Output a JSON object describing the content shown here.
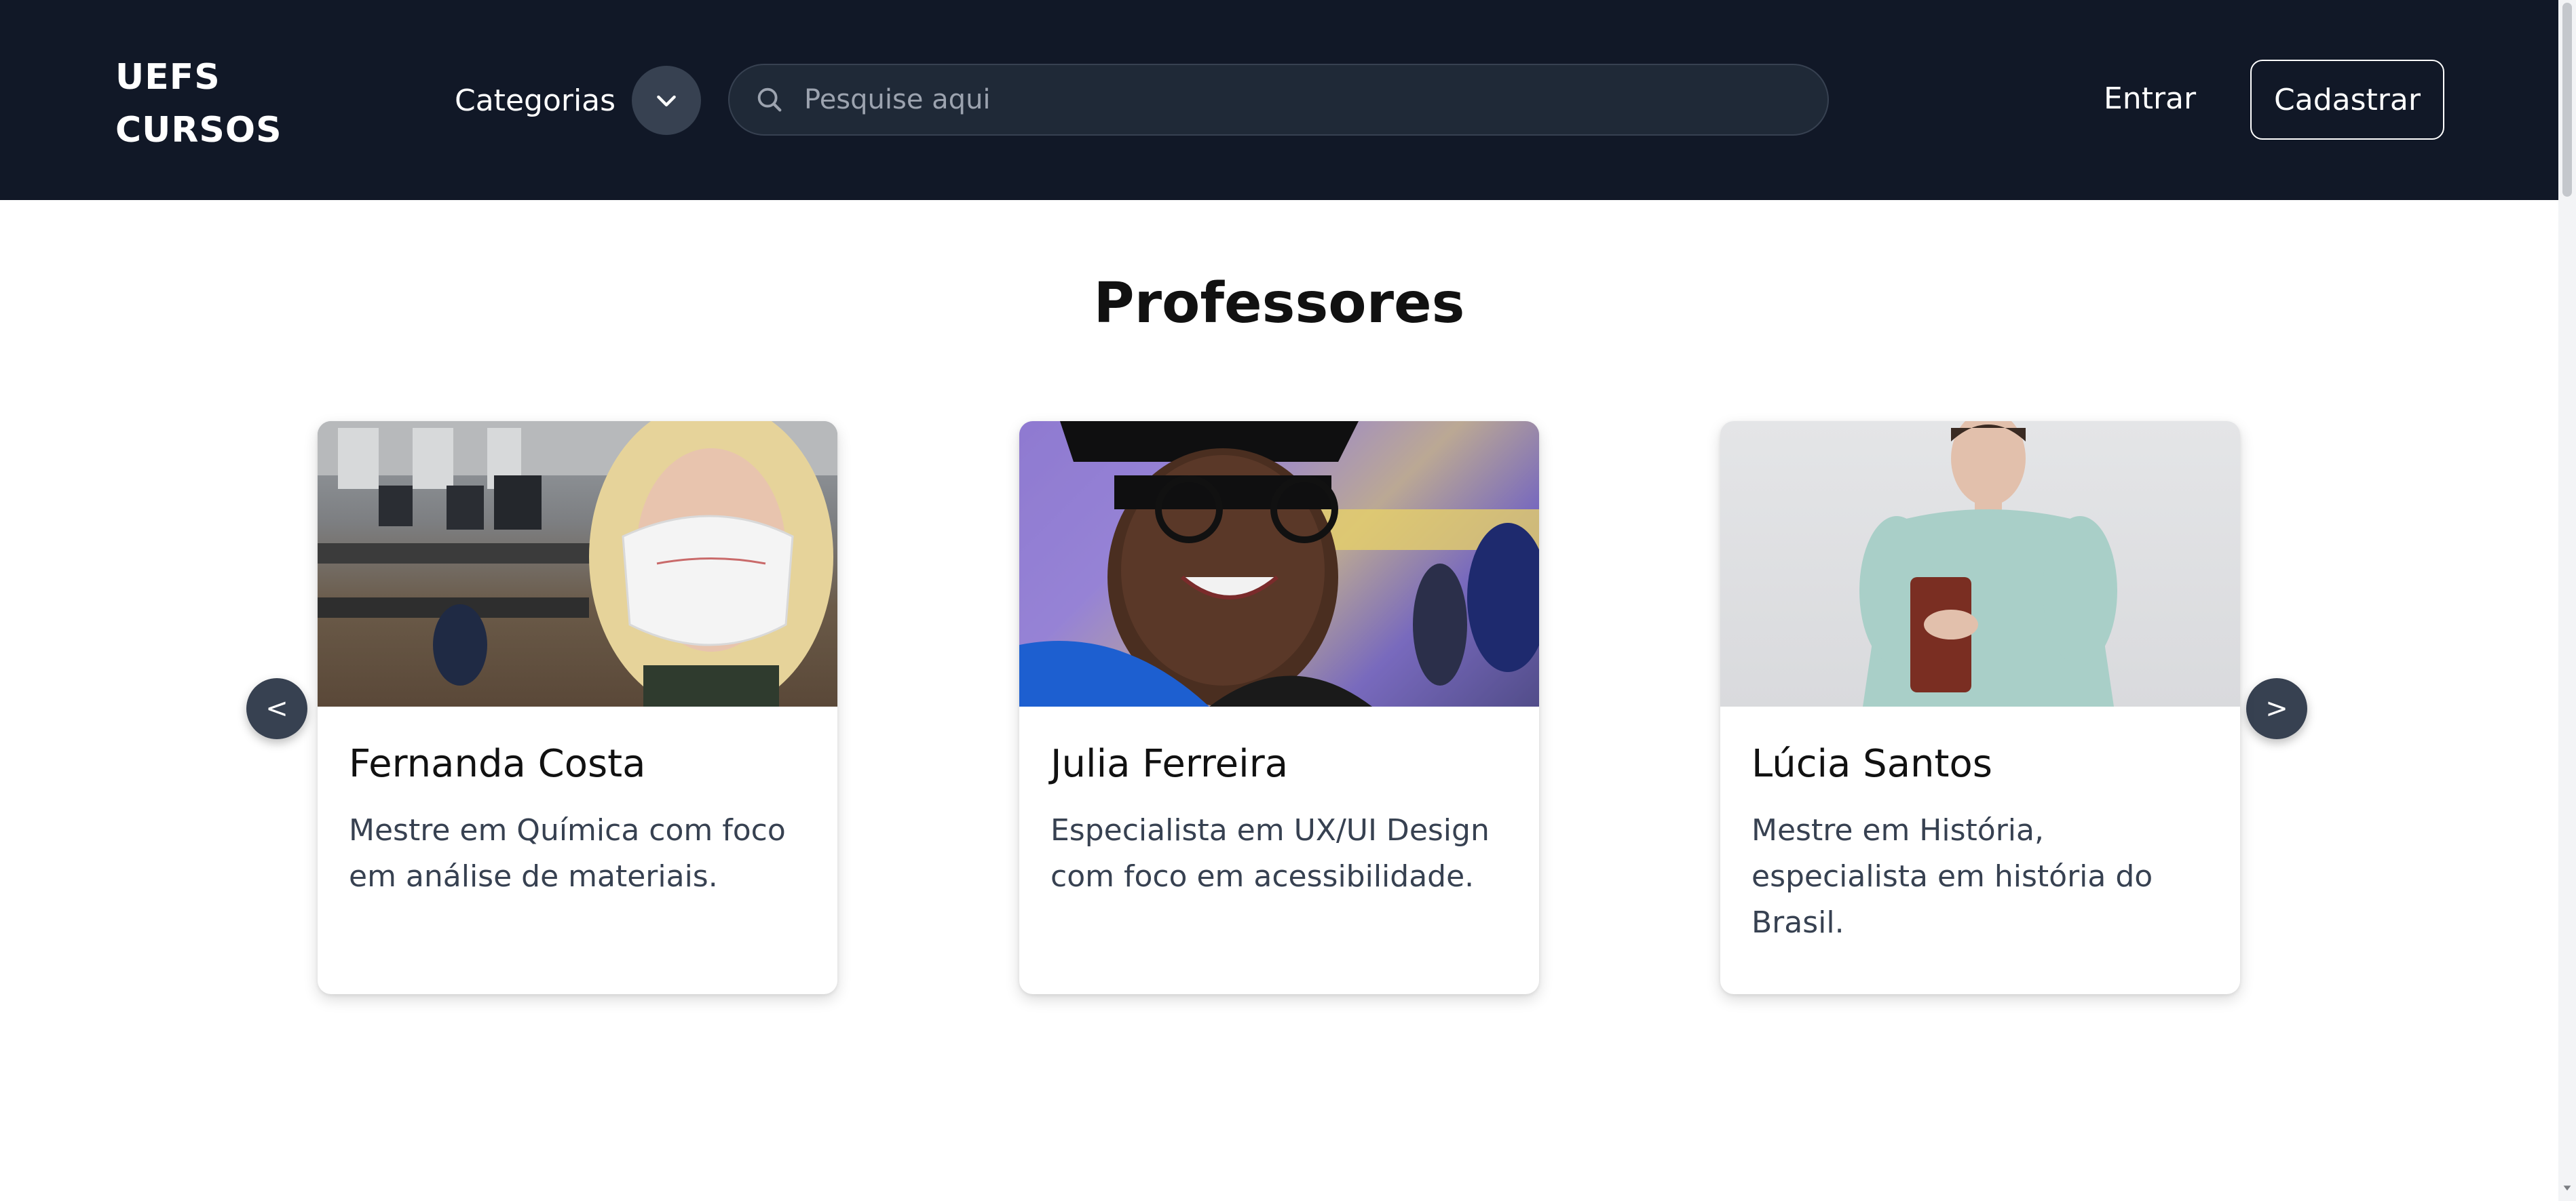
{
  "header": {
    "logo_line1": "UEFS",
    "logo_line2": "CURSOS",
    "categories_label": "Categorias",
    "search_placeholder": "Pesquise aqui",
    "login_label": "Entrar",
    "register_label": "Cadastrar"
  },
  "main": {
    "title": "Professores",
    "prev_label": "<",
    "next_label": ">",
    "cards": [
      {
        "name": "Fernanda Costa",
        "description": "Mestre em Química com foco em análise de materiais."
      },
      {
        "name": "Julia Ferreira",
        "description": "Especialista em UX/UI Design com foco em acessibilidade."
      },
      {
        "name": "Lúcia Santos",
        "description": "Mestre em História, especialista em história do Brasil."
      }
    ]
  },
  "colors": {
    "header_bg": "#111827",
    "search_bg": "#1f2937",
    "button_dark": "#374151"
  },
  "icons": {
    "categories_toggle": "chevron-down-icon",
    "search": "search-icon"
  }
}
